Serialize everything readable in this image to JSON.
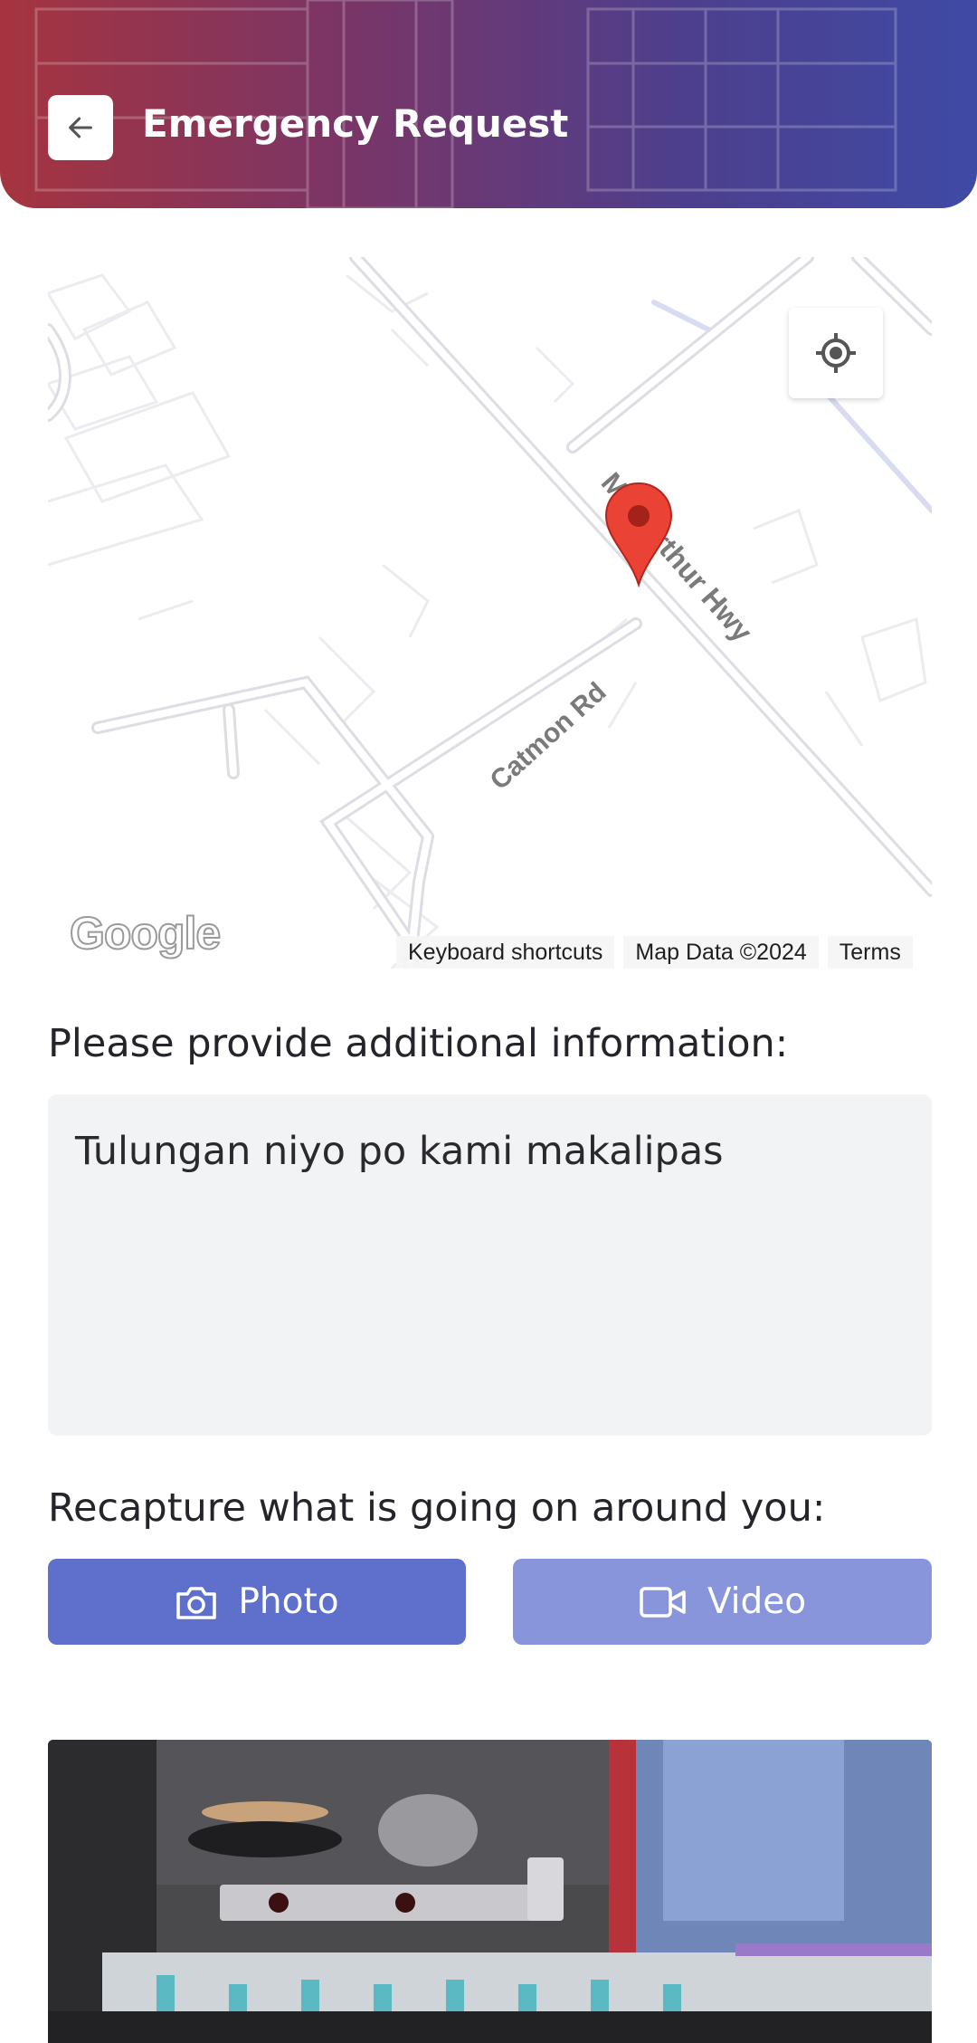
{
  "header": {
    "title": "Emergency Request",
    "back_icon": "arrow-left-icon",
    "gradient_start": "#a6343f",
    "gradient_end": "#3f4aa5"
  },
  "map": {
    "road_labels": [
      "MacArthur Hwy",
      "Catmon Rd"
    ],
    "logo_text": "Google",
    "footer_links": [
      "Keyboard shortcuts",
      "Map Data ©2024",
      "Terms"
    ],
    "pin_color": "#ea4335",
    "locate_icon": "my-location-icon"
  },
  "form": {
    "info_label": "Please provide additional information:",
    "info_value": "Tulungan niyo po kami makalipas",
    "capture_label": "Recapture what is going on around you:",
    "photo_button": "Photo",
    "video_button": "Video",
    "photo_icon": "camera-icon",
    "video_icon": "video-camera-icon"
  },
  "colors": {
    "primary": "#5e6fcc",
    "primary_light": "#8895db",
    "input_bg": "#f2f3f5"
  }
}
